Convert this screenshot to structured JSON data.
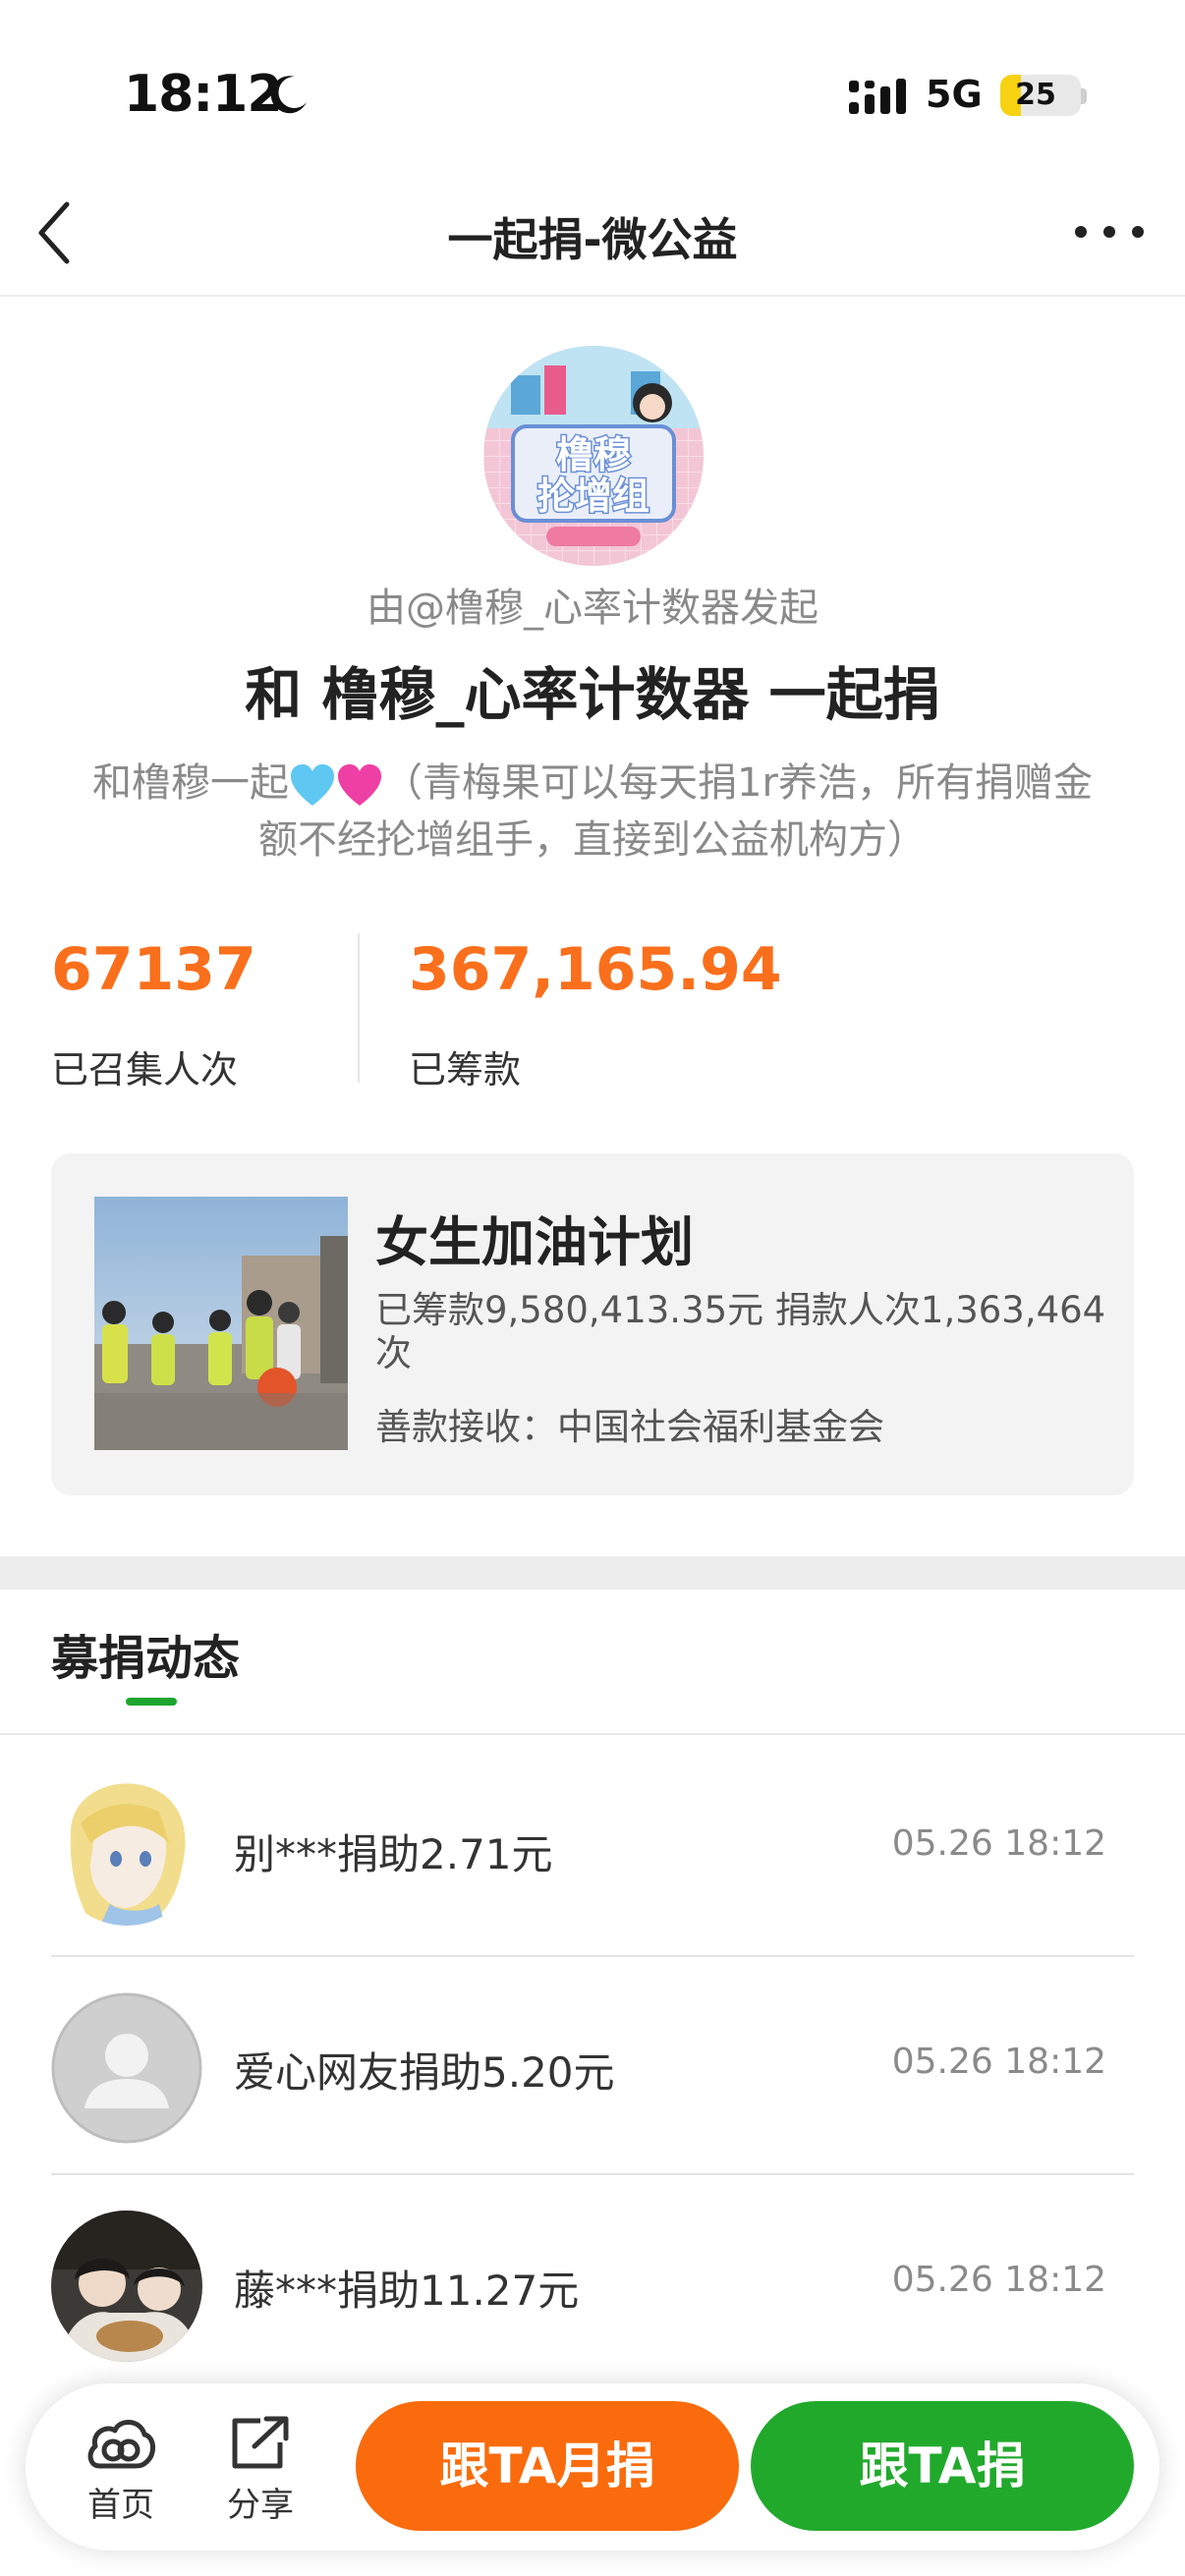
{
  "status_bar": {
    "time": "18:12",
    "network": "5G",
    "battery": "25",
    "battery_level_percent": 25
  },
  "nav": {
    "title": "一起捐-微公益",
    "icons": [
      "back-icon",
      "more-icon"
    ]
  },
  "campaign": {
    "avatar_text": "橹穆抡增组",
    "initiator": "由@橹穆_心率计数器发起",
    "headline": "和 橹穆_心率计数器 一起捐",
    "slogan_before": "和橹穆一起",
    "slogan_after": "（青梅果可以每天捐1r养浩，所有捐赠金额不经抡增组手，直接到公益机构方）",
    "colors": {
      "heart_blue": "#5ec8f2",
      "heart_pink": "#ee3fa5"
    }
  },
  "stats": {
    "participants_value": "67137",
    "participants_label": "已召集人次",
    "raised_value": "367,165.94",
    "raised_label": "已筹款"
  },
  "project": {
    "title": "女生加油计划",
    "stats_text": "已筹款9,580,413.35元  捐款人次1,363,464次",
    "recipient": "善款接收：中国社会福利基金会"
  },
  "section": {
    "title": "募捐动态"
  },
  "donations": [
    {
      "text": "别***捐助2.71元",
      "time": "05.26 18:12",
      "avatar": "anime-avatar"
    },
    {
      "text": "爱心网友捐助5.20元",
      "time": "05.26 18:12",
      "avatar": "default-avatar"
    },
    {
      "text": "藤***捐助11.27元",
      "time": "05.26 18:12",
      "avatar": "photo-avatar"
    }
  ],
  "bottom_bar": {
    "home_label": "首页",
    "share_label": "分享",
    "monthly_button": "跟TA月捐",
    "donate_button": "跟TA捐"
  },
  "colors": {
    "accent_orange": "#f96b0c",
    "accent_green": "#21a92c",
    "stat_orange": "#fa6f1c"
  }
}
